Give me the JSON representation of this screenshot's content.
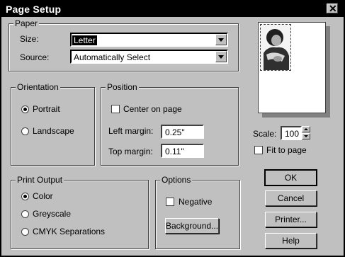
{
  "window": {
    "title": "Page Setup"
  },
  "paper": {
    "group_label": "Paper",
    "size_label": "Size:",
    "size_value": "Letter",
    "source_label": "Source:",
    "source_value": "Automatically Select"
  },
  "orientation": {
    "group_label": "Orientation",
    "portrait_label": "Portrait",
    "landscape_label": "Landscape",
    "selected": "Portrait"
  },
  "position": {
    "group_label": "Position",
    "center_label": "Center on page",
    "center_checked": false,
    "left_margin_label": "Left margin:",
    "left_margin_value": "0.25\"",
    "top_margin_label": "Top margin:",
    "top_margin_value": "0.11\""
  },
  "scale": {
    "label": "Scale:",
    "value": "100",
    "fit_label": "Fit to page",
    "fit_checked": false
  },
  "print_output": {
    "group_label": "Print Output",
    "options": [
      "Color",
      "Greyscale",
      "CMYK Separations"
    ],
    "selected": "Color"
  },
  "options": {
    "group_label": "Options",
    "negative_label": "Negative",
    "negative_checked": false,
    "background_button": "Background..."
  },
  "buttons": {
    "ok": "OK",
    "cancel": "Cancel",
    "printer": "Printer...",
    "help": "Help"
  },
  "icons": [
    "close-icon",
    "dropdown-arrow-icon",
    "spin-up-icon",
    "spin-down-icon"
  ]
}
